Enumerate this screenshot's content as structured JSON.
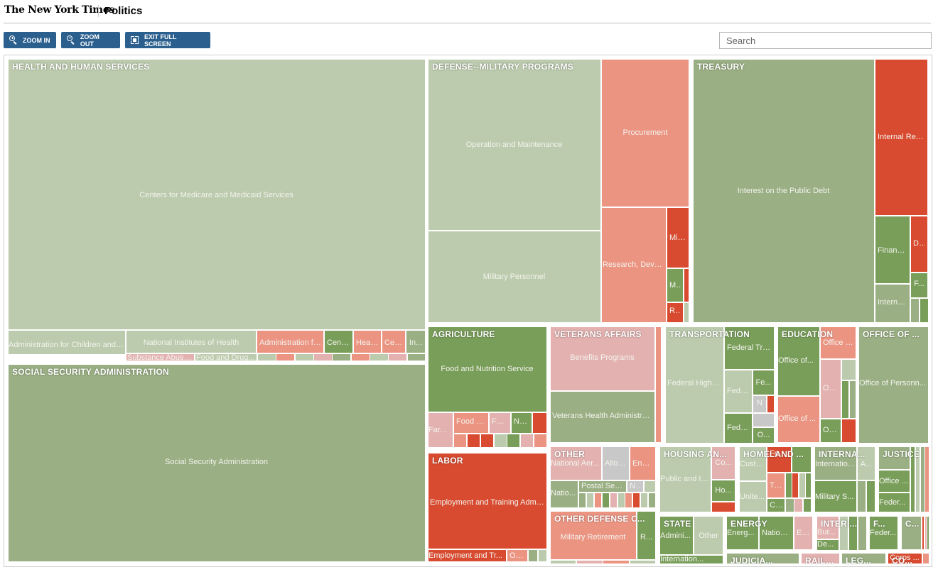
{
  "header": {
    "logo": "The New York Times",
    "section": "Politics"
  },
  "toolbar": {
    "zoom_in": "ZOOM IN",
    "zoom_out": "ZOOM OUT",
    "exit_full_screen": "EXIT FULL SCREEN"
  },
  "search": {
    "placeholder": "Search"
  },
  "colors": {
    "dark_green": "#799e5a",
    "olive": "#9aaf83",
    "light_green": "#bccbad",
    "light_red": "#e3b2b0",
    "salmon": "#ec9482",
    "red": "#d84b30",
    "gray": "#c8c8c8"
  },
  "chart_data": {
    "type": "treemap",
    "departments": [
      {
        "name": "HEALTH AND HUMAN SERVICES",
        "agencies": [
          "Centers for Medicare and Medicaid Services",
          "Administration for Children and ...",
          "National Institutes of Health",
          "Administration fo...",
          "Cente...",
          "Healt...",
          "Cen...",
          "In...",
          "Substance Abuse...",
          "Food and Drug..."
        ]
      },
      {
        "name": "SOCIAL SECURITY ADMINISTRATION",
        "agencies": [
          "Social Security Administration"
        ]
      },
      {
        "name": "DEFENSE--MILITARY PROGRAMS",
        "agencies": [
          "Operation and Maintenance",
          "Military Personnel",
          "Procurement",
          "Research, Deve...",
          "Milit...",
          "Mi...",
          "R..."
        ]
      },
      {
        "name": "TREASURY",
        "agencies": [
          "Interest on the Public Debt",
          "Internal Rev...",
          "Financi...",
          "D...",
          "Internal...",
          "F..."
        ]
      },
      {
        "name": "AGRICULTURE",
        "agencies": [
          "Food and Nutrition Service",
          "Far...",
          "Food a...",
          "For...",
          "Nat..."
        ]
      },
      {
        "name": "VETERANS AFFAIRS",
        "agencies": [
          "Benefits Programs",
          "Veterans Health Administrat..."
        ]
      },
      {
        "name": "TRANSPORTATION",
        "agencies": [
          "Federal Highw...",
          "Federal Tra...",
          "Fede...",
          "Fe...",
          "N",
          "Fede...",
          "O..."
        ]
      },
      {
        "name": "EDUCATION",
        "agencies": [
          "Office of...",
          "Office o...",
          "Offi...",
          "Office of ...",
          "Offi..."
        ]
      },
      {
        "name": "OFFICE OF ...",
        "agencies": [
          "Office of Personn..."
        ]
      },
      {
        "name": "LABOR",
        "agencies": [
          "Employment and Training Admi...",
          "Employment and Tr...",
          "Offi..."
        ]
      },
      {
        "name": "OTHER",
        "agencies": [
          "National Aer...",
          "Allow...",
          "Envi...",
          "Natio...",
          "Postal Service",
          "N..."
        ]
      },
      {
        "name": "OTHER DEFENSE C...",
        "agencies": [
          "Military Retirement",
          "R..."
        ]
      },
      {
        "name": "HOUSING AN...",
        "agencies": [
          "Public and In...",
          "Co...",
          "Ho..."
        ]
      },
      {
        "name": "HOMELAND ...",
        "agencies": [
          "Cust...",
          "Fed...",
          "Tr...",
          "Unite...",
          "Cit..."
        ]
      },
      {
        "name": "INTERNA...",
        "agencies": [
          "Internatio...",
          "A...",
          "Military S..."
        ]
      },
      {
        "name": "JUSTICE",
        "agencies": [
          "Office ...",
          "Feder..."
        ]
      },
      {
        "name": "STATE",
        "agencies": [
          "Admini...",
          "Other",
          "Internation..."
        ]
      },
      {
        "name": "ENERGY",
        "agencies": [
          "Energ...",
          "Nationa...",
          "En..."
        ]
      },
      {
        "name": "INTERI...",
        "agencies": [
          "Bur...",
          "De..."
        ]
      },
      {
        "name": "F...",
        "agencies": [
          "Feder..."
        ]
      },
      {
        "name": "C...",
        "agencies": []
      },
      {
        "name": "JUDICIA...",
        "agencies": []
      },
      {
        "name": "RAILRO...",
        "agencies": []
      },
      {
        "name": "LEG...",
        "agencies": []
      },
      {
        "name": "CO...",
        "agencies": [
          "Corps ..."
        ]
      }
    ]
  }
}
